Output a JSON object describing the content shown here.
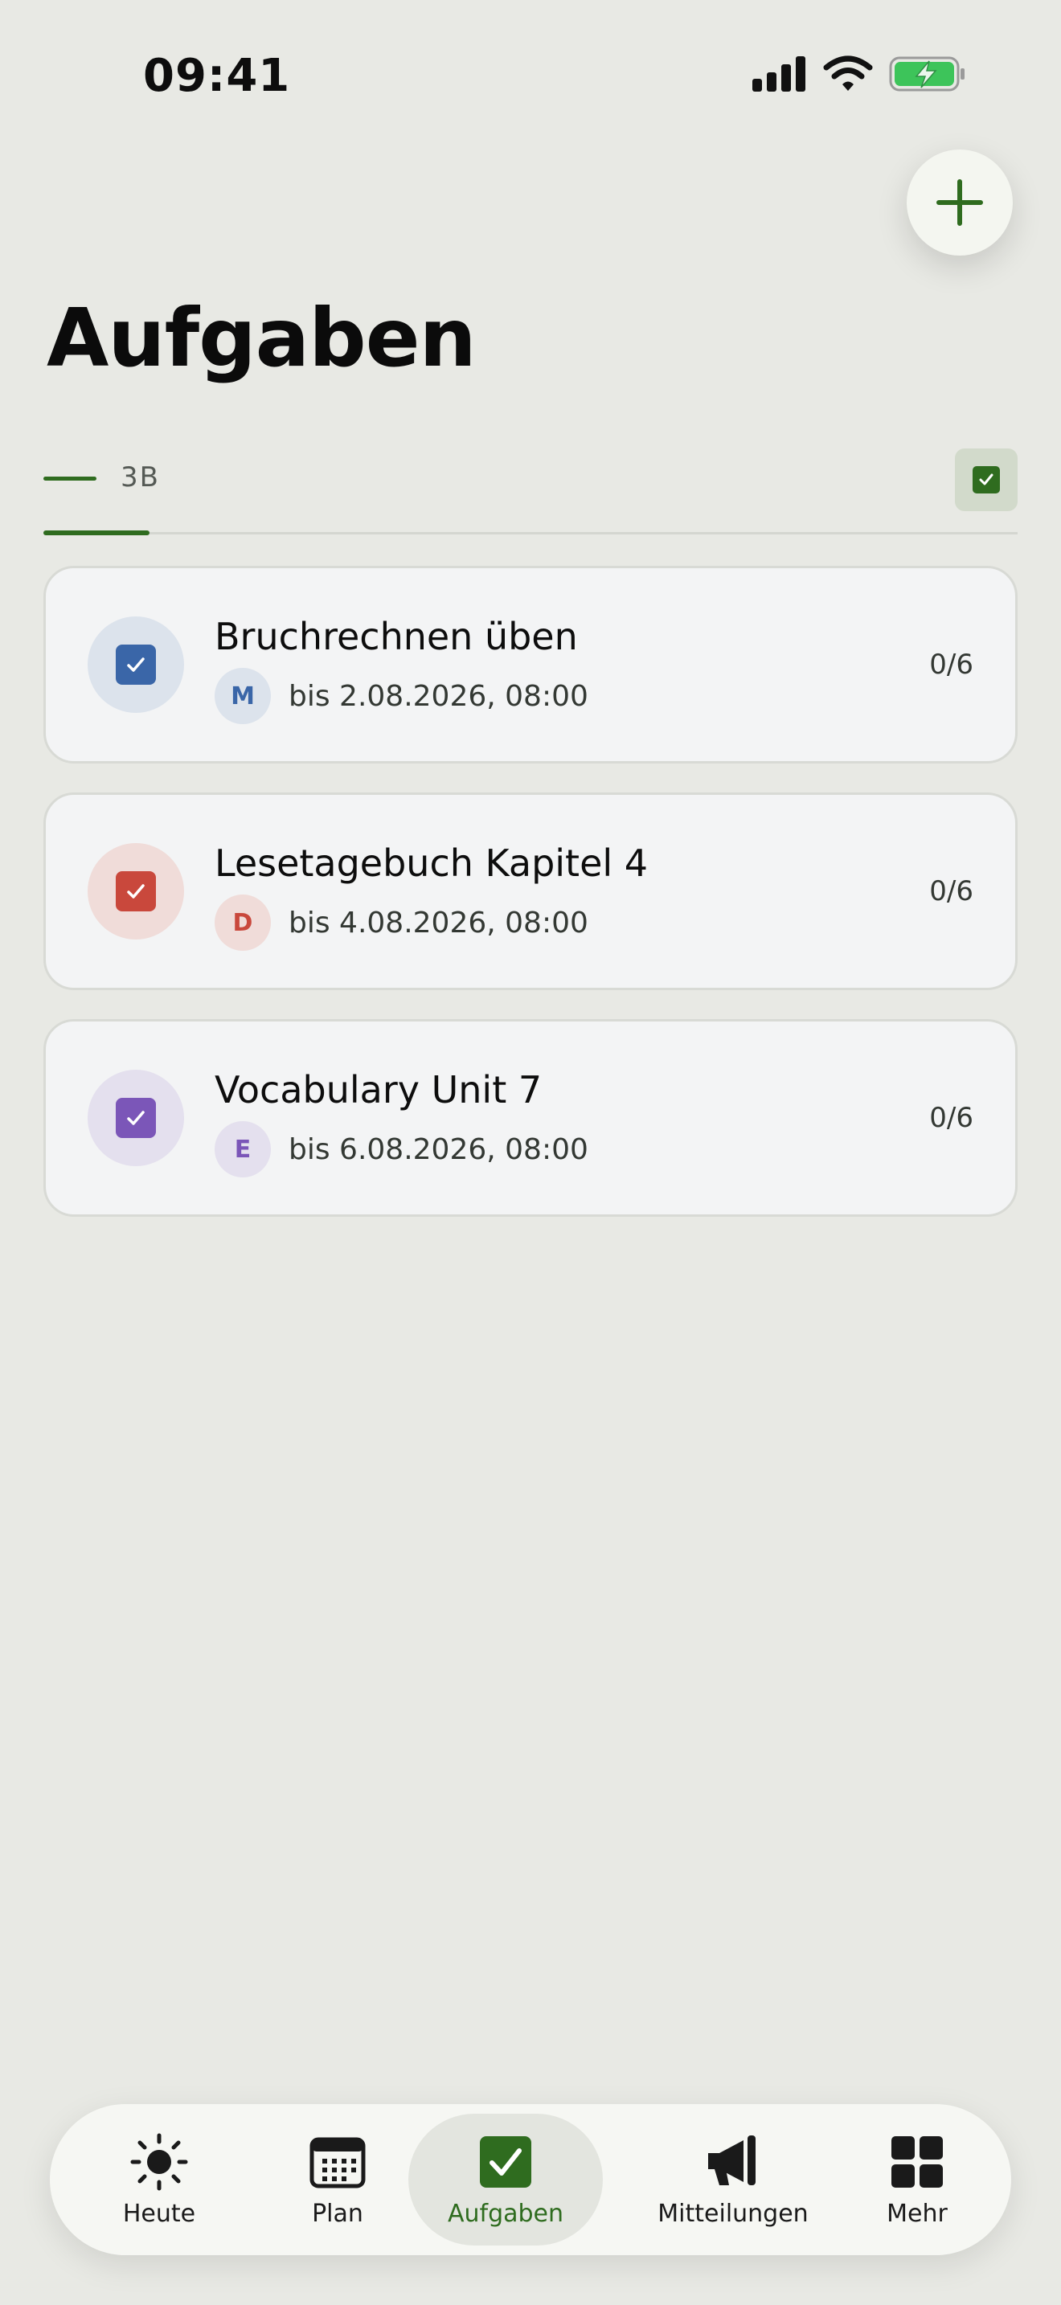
{
  "status_bar": {
    "time": "09:41"
  },
  "header": {
    "title": "Aufgaben"
  },
  "class_tabs": {
    "active": "3B"
  },
  "tasks": [
    {
      "title": "Bruchrechnen üben",
      "subject_initial": "M",
      "due": "bis 2.08.2026, 08:00",
      "count": "0/6",
      "accent": "#3a66a8",
      "tint": "#dce3ec",
      "badge_tint": "#dce3ec"
    },
    {
      "title": "Lesetagebuch Kapitel 4",
      "subject_initial": "D",
      "due": "bis 4.08.2026, 08:00",
      "count": "0/6",
      "accent": "#c9483c",
      "tint": "#f0dcd9",
      "badge_tint": "#f0dcd9"
    },
    {
      "title": "Vocabulary Unit 7",
      "subject_initial": "E",
      "due": "bis 6.08.2026, 08:00",
      "count": "0/6",
      "accent": "#7b56b8",
      "tint": "#e4e0ee",
      "badge_tint": "#e4e0ee"
    }
  ],
  "nav": {
    "items": [
      {
        "label": "Heute",
        "icon": "sun-icon"
      },
      {
        "label": "Plan",
        "icon": "calendar-icon"
      },
      {
        "label": "Aufgaben",
        "icon": "checkbox-icon"
      },
      {
        "label": "Mitteilungen",
        "icon": "megaphone-icon"
      },
      {
        "label": "Mehr",
        "icon": "grid-icon"
      }
    ],
    "active_index": 2
  },
  "colors": {
    "accent": "#2f6c1f",
    "background": "#e8e9e4",
    "battery": "#3dc45a"
  }
}
